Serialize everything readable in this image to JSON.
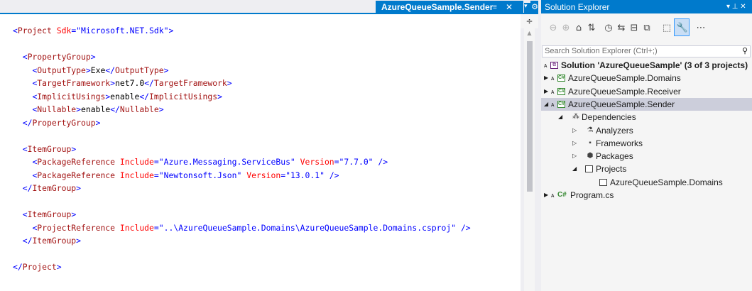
{
  "editor": {
    "tab_title": "AzureQueueSample.Sender",
    "tab_pin_glyph": "≡",
    "tab_close_glyph": "✕",
    "tab_dropdown_glyph": "▾",
    "tab_gear_glyph": "⚙",
    "split_glyph": "÷",
    "code_lines": [
      [
        {
          "t": "punct",
          "v": "<"
        },
        {
          "t": "tag",
          "v": "Project"
        },
        {
          "t": "attr",
          "v": " Sdk"
        },
        {
          "t": "punct",
          "v": "="
        },
        {
          "t": "val",
          "v": "\"Microsoft.NET.Sdk\""
        },
        {
          "t": "punct",
          "v": ">"
        }
      ],
      [],
      [
        {
          "t": "text",
          "v": "  "
        },
        {
          "t": "punct",
          "v": "<"
        },
        {
          "t": "tag",
          "v": "PropertyGroup"
        },
        {
          "t": "punct",
          "v": ">"
        }
      ],
      [
        {
          "t": "text",
          "v": "    "
        },
        {
          "t": "punct",
          "v": "<"
        },
        {
          "t": "tag",
          "v": "OutputType"
        },
        {
          "t": "punct",
          "v": ">"
        },
        {
          "t": "text",
          "v": "Exe"
        },
        {
          "t": "punct",
          "v": "</"
        },
        {
          "t": "tag",
          "v": "OutputType"
        },
        {
          "t": "punct",
          "v": ">"
        }
      ],
      [
        {
          "t": "text",
          "v": "    "
        },
        {
          "t": "punct",
          "v": "<"
        },
        {
          "t": "tag",
          "v": "TargetFramework"
        },
        {
          "t": "punct",
          "v": ">"
        },
        {
          "t": "text",
          "v": "net7.0"
        },
        {
          "t": "punct",
          "v": "</"
        },
        {
          "t": "tag",
          "v": "TargetFramework"
        },
        {
          "t": "punct",
          "v": ">"
        }
      ],
      [
        {
          "t": "text",
          "v": "    "
        },
        {
          "t": "punct",
          "v": "<"
        },
        {
          "t": "tag",
          "v": "ImplicitUsings"
        },
        {
          "t": "punct",
          "v": ">"
        },
        {
          "t": "text",
          "v": "enable"
        },
        {
          "t": "punct",
          "v": "</"
        },
        {
          "t": "tag",
          "v": "ImplicitUsings"
        },
        {
          "t": "punct",
          "v": ">"
        }
      ],
      [
        {
          "t": "text",
          "v": "    "
        },
        {
          "t": "punct",
          "v": "<"
        },
        {
          "t": "tag",
          "v": "Nullable"
        },
        {
          "t": "punct",
          "v": ">"
        },
        {
          "t": "text",
          "v": "enable"
        },
        {
          "t": "punct",
          "v": "</"
        },
        {
          "t": "tag",
          "v": "Nullable"
        },
        {
          "t": "punct",
          "v": ">"
        }
      ],
      [
        {
          "t": "text",
          "v": "  "
        },
        {
          "t": "punct",
          "v": "</"
        },
        {
          "t": "tag",
          "v": "PropertyGroup"
        },
        {
          "t": "punct",
          "v": ">"
        }
      ],
      [],
      [
        {
          "t": "text",
          "v": "  "
        },
        {
          "t": "punct",
          "v": "<"
        },
        {
          "t": "tag",
          "v": "ItemGroup"
        },
        {
          "t": "punct",
          "v": ">"
        }
      ],
      [
        {
          "t": "text",
          "v": "    "
        },
        {
          "t": "punct",
          "v": "<"
        },
        {
          "t": "tag",
          "v": "PackageReference"
        },
        {
          "t": "attr",
          "v": " Include"
        },
        {
          "t": "punct",
          "v": "="
        },
        {
          "t": "val",
          "v": "\"Azure.Messaging.ServiceBus\""
        },
        {
          "t": "attr",
          "v": " Version"
        },
        {
          "t": "punct",
          "v": "="
        },
        {
          "t": "val",
          "v": "\"7.7.0\""
        },
        {
          "t": "punct",
          "v": " />"
        }
      ],
      [
        {
          "t": "text",
          "v": "    "
        },
        {
          "t": "punct",
          "v": "<"
        },
        {
          "t": "tag",
          "v": "PackageReference"
        },
        {
          "t": "attr",
          "v": " Include"
        },
        {
          "t": "punct",
          "v": "="
        },
        {
          "t": "val",
          "v": "\"Newtonsoft.Json\""
        },
        {
          "t": "attr",
          "v": " Version"
        },
        {
          "t": "punct",
          "v": "="
        },
        {
          "t": "val",
          "v": "\"13.0.1\""
        },
        {
          "t": "punct",
          "v": " />"
        }
      ],
      [
        {
          "t": "text",
          "v": "  "
        },
        {
          "t": "punct",
          "v": "</"
        },
        {
          "t": "tag",
          "v": "ItemGroup"
        },
        {
          "t": "punct",
          "v": ">"
        }
      ],
      [],
      [
        {
          "t": "text",
          "v": "  "
        },
        {
          "t": "punct",
          "v": "<"
        },
        {
          "t": "tag",
          "v": "ItemGroup"
        },
        {
          "t": "punct",
          "v": ">"
        }
      ],
      [
        {
          "t": "text",
          "v": "    "
        },
        {
          "t": "punct",
          "v": "<"
        },
        {
          "t": "tag",
          "v": "ProjectReference"
        },
        {
          "t": "attr",
          "v": " Include"
        },
        {
          "t": "punct",
          "v": "="
        },
        {
          "t": "val",
          "v": "\"..\\AzureQueueSample.Domains\\AzureQueueSample.Domains.csproj\""
        },
        {
          "t": "punct",
          "v": " />"
        }
      ],
      [
        {
          "t": "text",
          "v": "  "
        },
        {
          "t": "punct",
          "v": "</"
        },
        {
          "t": "tag",
          "v": "ItemGroup"
        },
        {
          "t": "punct",
          "v": ">"
        }
      ],
      [],
      [
        {
          "t": "punct",
          "v": "</"
        },
        {
          "t": "tag",
          "v": "Project"
        },
        {
          "t": "punct",
          "v": ">"
        }
      ]
    ]
  },
  "solution_explorer": {
    "title": "Solution Explorer",
    "title_buttons": "▾ ⊥ ✕",
    "search_placeholder": "Search Solution Explorer (Ctrl+;)",
    "toolbar_icons": [
      {
        "name": "back-icon",
        "glyph": "⊖",
        "disabled": true
      },
      {
        "name": "forward-icon",
        "glyph": "⊕",
        "disabled": true
      },
      {
        "name": "home-icon",
        "glyph": "⌂",
        "disabled": false
      },
      {
        "name": "switch-views-icon",
        "glyph": "⇅",
        "disabled": false
      },
      {
        "name": "pending-changes-icon",
        "glyph": "◷",
        "disabled": false
      },
      {
        "name": "sync-icon",
        "glyph": "⇆",
        "disabled": false
      },
      {
        "name": "collapse-all-icon",
        "glyph": "⊟",
        "disabled": false
      },
      {
        "name": "show-all-files-icon",
        "glyph": "⧉",
        "disabled": false
      },
      {
        "name": "preview-selected-icon",
        "glyph": "⬚",
        "disabled": false
      },
      {
        "name": "properties-icon",
        "glyph": "🔧",
        "disabled": false
      },
      {
        "name": "more-icon",
        "glyph": "⋯",
        "disabled": false
      }
    ],
    "tree": [
      {
        "label": "Solution 'AzureQueueSample' (3 of 3 projects)",
        "icon": "sln",
        "lock": true,
        "expander": "",
        "depth": 0,
        "bold": true
      },
      {
        "label": "AzureQueueSample.Domains",
        "icon": "csproj",
        "lock": true,
        "expander": "▶",
        "depth": 0
      },
      {
        "label": "AzureQueueSample.Receiver",
        "icon": "csproj",
        "lock": true,
        "expander": "▶",
        "depth": 0
      },
      {
        "label": "AzureQueueSample.Sender",
        "icon": "csproj",
        "lock": true,
        "expander": "◢",
        "depth": 0,
        "selected": true
      },
      {
        "label": "Dependencies",
        "icon": "deps",
        "lock": false,
        "expander": "◢",
        "depth": 1,
        "icon_glyph": "⁂"
      },
      {
        "label": "Analyzers",
        "icon": "deps",
        "lock": false,
        "expander": "▷",
        "depth": 2,
        "icon_glyph": "⚗"
      },
      {
        "label": "Frameworks",
        "icon": "deps",
        "lock": false,
        "expander": "▷",
        "depth": 2,
        "icon_glyph": "▪"
      },
      {
        "label": "Packages",
        "icon": "deps",
        "lock": false,
        "expander": "▷",
        "depth": 2,
        "icon_glyph": "⬢"
      },
      {
        "label": "Projects",
        "icon": "win",
        "lock": false,
        "expander": "◢",
        "depth": 2
      },
      {
        "label": "AzureQueueSample.Domains",
        "icon": "win",
        "lock": false,
        "expander": "",
        "depth": 3
      },
      {
        "label": "Program.cs",
        "icon": "cs",
        "lock": true,
        "expander": "▶",
        "depth": 0,
        "cs_label": "C#"
      }
    ]
  }
}
